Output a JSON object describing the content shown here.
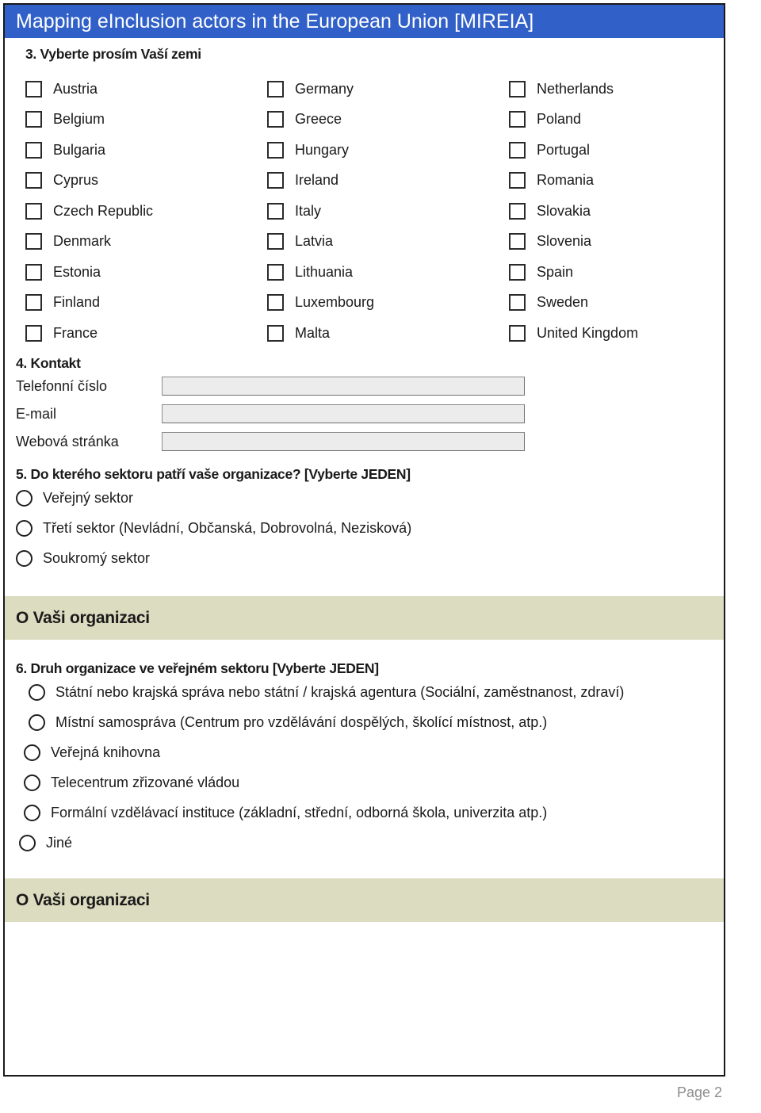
{
  "header": {
    "title": "Mapping eInclusion actors in the European Union [MIREIA]",
    "banner_color": "#3160c8"
  },
  "q3": {
    "heading": "3. Vyberte prosím Vaší zemi",
    "columns": [
      [
        {
          "label": "Austria",
          "checked": false
        },
        {
          "label": "Belgium",
          "checked": false
        },
        {
          "label": "Bulgaria",
          "checked": false
        },
        {
          "label": "Cyprus",
          "checked": false
        },
        {
          "label": "Czech Republic",
          "checked": false
        },
        {
          "label": "Denmark",
          "checked": false
        },
        {
          "label": "Estonia",
          "checked": false
        },
        {
          "label": "Finland",
          "checked": false
        },
        {
          "label": "France",
          "checked": false
        }
      ],
      [
        {
          "label": "Germany",
          "checked": false
        },
        {
          "label": "Greece",
          "checked": false
        },
        {
          "label": "Hungary",
          "checked": false
        },
        {
          "label": "Ireland",
          "checked": false
        },
        {
          "label": "Italy",
          "checked": false
        },
        {
          "label": "Latvia",
          "checked": false
        },
        {
          "label": "Lithuania",
          "checked": false
        },
        {
          "label": "Luxembourg",
          "checked": false
        },
        {
          "label": "Malta",
          "checked": false
        }
      ],
      [
        {
          "label": "Netherlands",
          "checked": false
        },
        {
          "label": "Poland",
          "checked": false
        },
        {
          "label": "Portugal",
          "checked": false
        },
        {
          "label": "Romania",
          "checked": false
        },
        {
          "label": "Slovakia",
          "checked": false
        },
        {
          "label": "Slovenia",
          "checked": false
        },
        {
          "label": "Spain",
          "checked": false
        },
        {
          "label": "Sweden",
          "checked": false
        },
        {
          "label": "United Kingdom",
          "checked": false
        }
      ]
    ]
  },
  "q4": {
    "heading": "4. Kontakt",
    "fields": [
      {
        "label": "Telefonní číslo",
        "value": "",
        "placeholder": ""
      },
      {
        "label": "E-mail",
        "value": "",
        "placeholder": ""
      },
      {
        "label": "Webová stránka",
        "value": "",
        "placeholder": ""
      }
    ]
  },
  "q5": {
    "heading": "5. Do kterého sektoru patří vaše organizace? [Vyberte JEDEN]",
    "options": [
      {
        "label": "Veřejný sektor",
        "selected": false
      },
      {
        "label": "Třetí sektor (Nevládní, Občanská, Dobrovolná, Nezisková)",
        "selected": false
      },
      {
        "label": "Soukromý sektor",
        "selected": false
      }
    ]
  },
  "band1": {
    "title": "O Vaši organizaci",
    "background_color": "#dcdcc0"
  },
  "q6": {
    "heading": "6. Druh organizace ve veřejném sektoru [Vyberte JEDEN]",
    "options": [
      {
        "label": "Státní nebo krajská správa nebo státní / krajská agentura (Sociální, zaměstnanost, zdraví)",
        "selected": false
      },
      {
        "label": "Místní samospráva (Centrum pro vzdělávání dospělých, školící místnost, atp.)",
        "selected": false
      },
      {
        "label": "Veřejná knihovna",
        "selected": false
      },
      {
        "label": "Telecentrum zřizované vládou",
        "selected": false
      },
      {
        "label": "Formální vzdělávací instituce (základní, střední, odborná škola, univerzita atp.)",
        "selected": false
      },
      {
        "label": "Jiné",
        "selected": false
      }
    ]
  },
  "band2": {
    "title": "O Vaši organizaci",
    "background_color": "#dcdcc0"
  },
  "footer": {
    "page_label": "Page 2"
  }
}
